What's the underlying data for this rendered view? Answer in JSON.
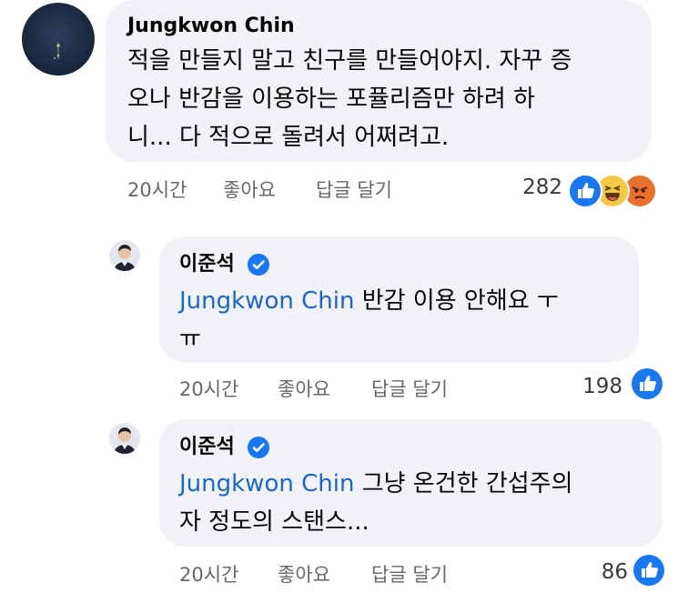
{
  "comments": [
    {
      "author": "Jungkwon Chin",
      "lines": [
        "적을 만들지 말고 친구를 만들어야지. 자꾸 증",
        "오나 반감을 이용하는 포퓰리즘만 하려 하",
        "니... 다 적으로 돌려서 어쩌려고."
      ],
      "time": "20시간",
      "like_label": "좋아요",
      "reply_label": "답글 달기",
      "reaction_count": "282",
      "reactions": [
        "like-icon",
        "haha-icon",
        "angry-icon"
      ]
    },
    {
      "author": "이준석",
      "verified": true,
      "mention": "Jungkwon Chin",
      "lines": [
        " 반감 이용 안해요 ㅜ",
        "ㅠ"
      ],
      "time": "20시간",
      "like_label": "좋아요",
      "reply_label": "답글 달기",
      "reaction_count": "198",
      "reactions": [
        "like-icon"
      ]
    },
    {
      "author": "이준석",
      "verified": true,
      "mention": "Jungkwon Chin",
      "lines": [
        " 그냥 온건한 간섭주의",
        "자 정도의 스탠스..."
      ],
      "time": "20시간",
      "like_label": "좋아요",
      "reply_label": "답글 달기",
      "reaction_count": "86",
      "reactions": [
        "like-icon"
      ]
    }
  ],
  "colors": {
    "bubble": "#f0f2f5",
    "mention": "#1b66c9",
    "like": "#1877f2",
    "meta": "#65676b"
  }
}
